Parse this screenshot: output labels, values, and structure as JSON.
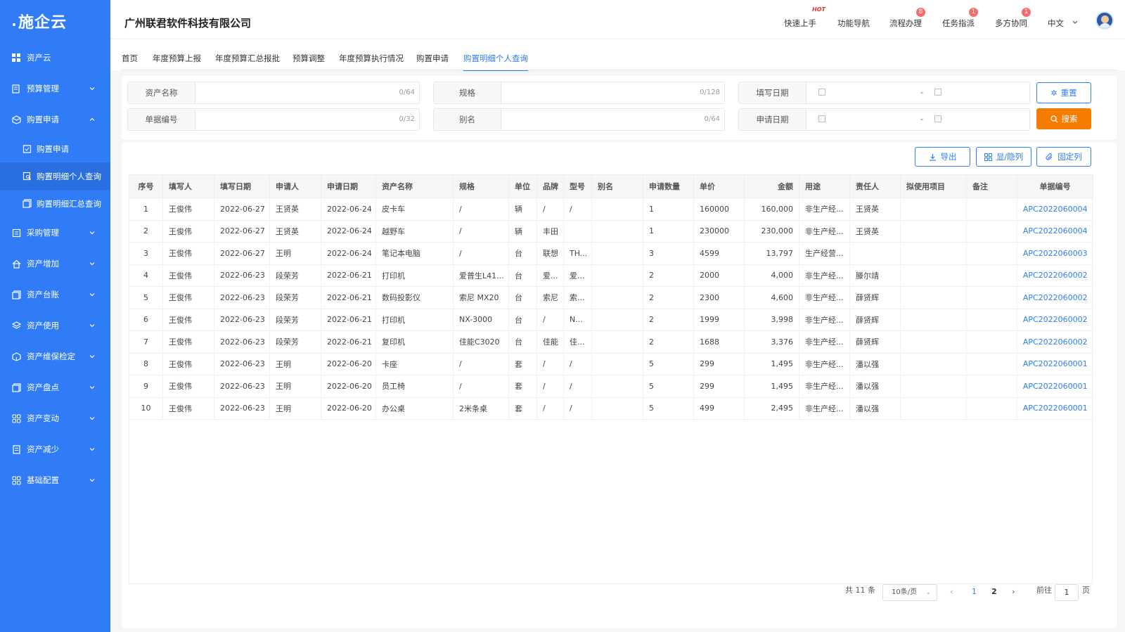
{
  "app": {
    "logo": "施企云",
    "company": "广州联君软件科技有限公司"
  },
  "header": {
    "items": [
      {
        "label": "快速上手",
        "tag": "HOT"
      },
      {
        "label": "功能导航"
      },
      {
        "label": "流程办理",
        "badge": "8"
      },
      {
        "label": "任务指派",
        "badge": "1"
      },
      {
        "label": "多方协同",
        "badge": "1"
      }
    ],
    "language": "中文"
  },
  "sidebar": {
    "items": [
      {
        "label": "资产云",
        "icon": "grid-icon"
      },
      {
        "label": "预算管理",
        "icon": "budget-icon"
      },
      {
        "label": "购置申请",
        "icon": "box-icon",
        "expanded": true
      },
      {
        "label": "采购管理",
        "icon": "clipboard-icon"
      },
      {
        "label": "资产增加",
        "icon": "home-icon"
      },
      {
        "label": "资产台账",
        "icon": "ledger-icon"
      },
      {
        "label": "资产使用",
        "icon": "layers-icon"
      },
      {
        "label": "资产维保检定",
        "icon": "cube-icon"
      },
      {
        "label": "资产盘点",
        "icon": "inventory-icon"
      },
      {
        "label": "资产变动",
        "icon": "apps-icon"
      },
      {
        "label": "资产减少",
        "icon": "doc-icon"
      },
      {
        "label": "基础配置",
        "icon": "apps-icon"
      }
    ],
    "subitems": [
      {
        "label": "购置申请"
      },
      {
        "label": "购置明细个人查询",
        "active": true
      },
      {
        "label": "购置明细汇总查询"
      }
    ]
  },
  "tabs": [
    "首页",
    "年度预算上报",
    "年度预算汇总报批",
    "预算调整",
    "年度预算执行情况",
    "购置申请",
    "购置明细个人查询"
  ],
  "filters": {
    "asset_name": {
      "label": "资产名称",
      "count": "0/64"
    },
    "spec": {
      "label": "规格",
      "count": "0/128"
    },
    "fill_date": {
      "label": "填写日期",
      "sep": "-"
    },
    "doc_no": {
      "label": "单据编号",
      "count": "0/32"
    },
    "alias": {
      "label": "别名",
      "count": "0/64"
    },
    "apply_date": {
      "label": "申请日期",
      "sep": "-"
    },
    "reset": "重置",
    "search": "搜索"
  },
  "toolbar": {
    "export": "导出",
    "columns": "显/隐列",
    "fix": "固定列"
  },
  "table": {
    "headers": [
      "序号",
      "填写人",
      "填写日期",
      "申请人",
      "申请日期",
      "资产名称",
      "规格",
      "单位",
      "品牌",
      "型号",
      "别名",
      "申请数量",
      "单价",
      "金额",
      "用途",
      "责任人",
      "拟使用项目",
      "备注",
      "单据编号"
    ],
    "rows": [
      [
        "1",
        "王俊伟",
        "2022-06-27",
        "王贤英",
        "2022-06-24",
        "皮卡车",
        "/",
        "辆",
        "/",
        "/",
        "",
        "1",
        "160000",
        "160,000",
        "非生产经...",
        "王贤英",
        "",
        "",
        "APC2022060004"
      ],
      [
        "2",
        "王俊伟",
        "2022-06-27",
        "王贤英",
        "2022-06-24",
        "越野车",
        "/",
        "辆",
        "丰田",
        "",
        "",
        "1",
        "230000",
        "230,000",
        "非生产经...",
        "王贤英",
        "",
        "",
        "APC2022060004"
      ],
      [
        "3",
        "王俊伟",
        "2022-06-27",
        "王明",
        "2022-06-24",
        "笔记本电脑",
        "/",
        "台",
        "联想",
        "TH...",
        "",
        "3",
        "4599",
        "13,797",
        "生产经营...",
        "",
        "",
        "",
        "APC2022060003"
      ],
      [
        "4",
        "王俊伟",
        "2022-06-23",
        "段荣芳",
        "2022-06-21",
        "打印机",
        "爱普生L41...",
        "台",
        "爱...",
        "爱...",
        "",
        "2",
        "2000",
        "4,000",
        "非生产经...",
        "滕尔靖",
        "",
        "",
        "APC2022060002"
      ],
      [
        "5",
        "王俊伟",
        "2022-06-23",
        "段荣芳",
        "2022-06-21",
        "数码投影仪",
        "索尼 MX20",
        "台",
        "索尼",
        "索...",
        "",
        "2",
        "2300",
        "4,600",
        "非生产经...",
        "薛贤辉",
        "",
        "",
        "APC2022060002"
      ],
      [
        "6",
        "王俊伟",
        "2022-06-23",
        "段荣芳",
        "2022-06-21",
        "打印机",
        "NX-3000",
        "台",
        "/",
        "N...",
        "",
        "2",
        "1999",
        "3,998",
        "非生产经...",
        "薛贤辉",
        "",
        "",
        "APC2022060002"
      ],
      [
        "7",
        "王俊伟",
        "2022-06-23",
        "段荣芳",
        "2022-06-21",
        "复印机",
        "佳能C3020",
        "台",
        "佳能",
        "佳...",
        "",
        "2",
        "1688",
        "3,376",
        "非生产经...",
        "薛贤辉",
        "",
        "",
        "APC2022060002"
      ],
      [
        "8",
        "王俊伟",
        "2022-06-23",
        "王明",
        "2022-06-20",
        "卡座",
        "/",
        "套",
        "/",
        "/",
        "",
        "5",
        "299",
        "1,495",
        "非生产经...",
        "潘以强",
        "",
        "",
        "APC2022060001"
      ],
      [
        "9",
        "王俊伟",
        "2022-06-23",
        "王明",
        "2022-06-20",
        "员工椅",
        "/",
        "套",
        "/",
        "/",
        "",
        "5",
        "299",
        "1,495",
        "非生产经...",
        "潘以强",
        "",
        "",
        "APC2022060001"
      ],
      [
        "10",
        "王俊伟",
        "2022-06-23",
        "王明",
        "2022-06-20",
        "办公桌",
        "2米条桌",
        "套",
        "/",
        "/",
        "",
        "5",
        "499",
        "2,495",
        "非生产经...",
        "潘以强",
        "",
        "",
        "APC2022060001"
      ]
    ]
  },
  "pagination": {
    "total": "共 11 条",
    "size": "10条/页",
    "pages": [
      "1",
      "2"
    ],
    "current": "1",
    "goto_label": "前往",
    "goto_value": "1",
    "goto_suffix": "页"
  },
  "colors": {
    "primary": "#2f7cf6",
    "search": "#f57c00",
    "badge": "#f56c6c"
  }
}
